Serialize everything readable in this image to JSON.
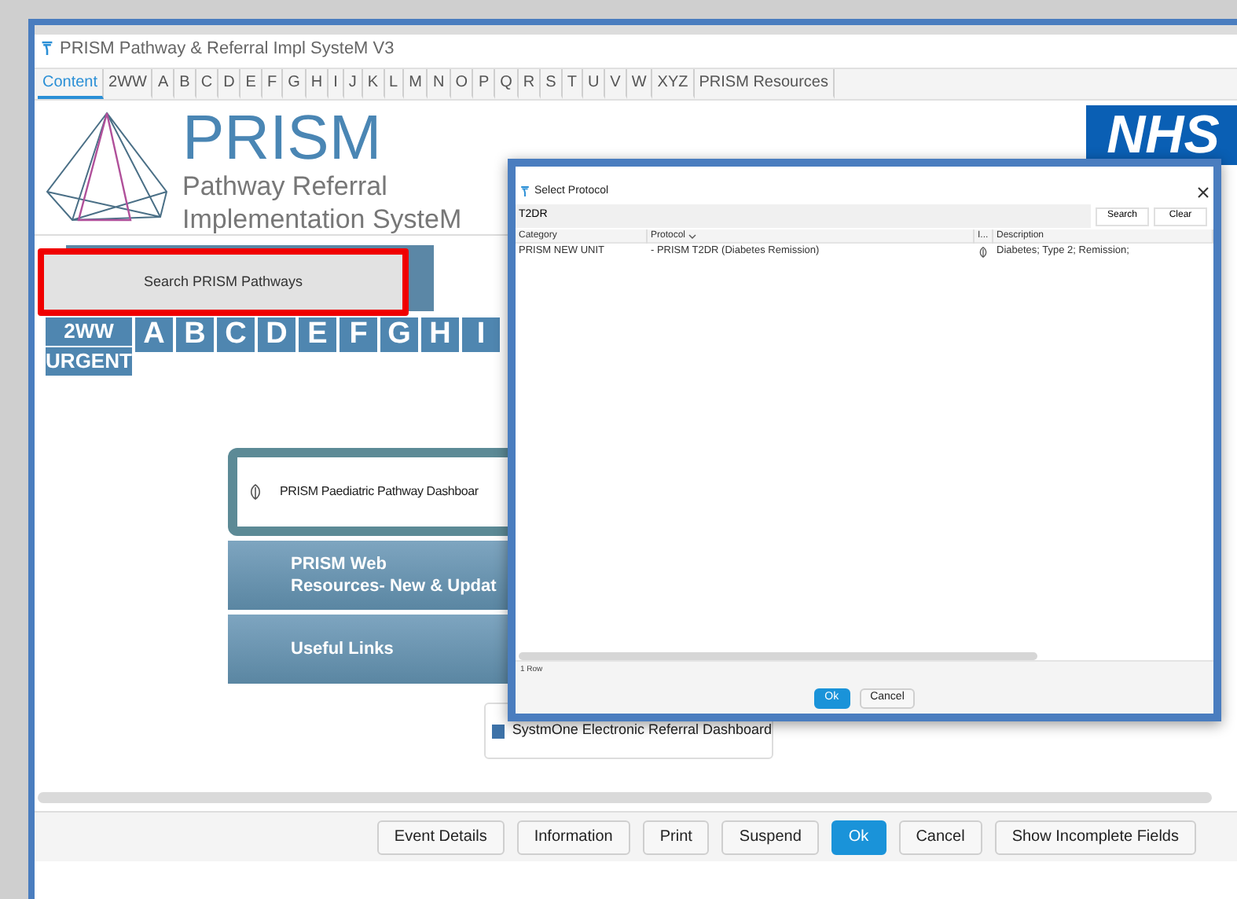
{
  "window": {
    "title": "PRISM Pathway & Referral Impl SysteM V3"
  },
  "tabs": [
    {
      "label": "Content",
      "selected": true
    },
    {
      "label": "2WW",
      "selected": false
    },
    {
      "label": "A",
      "selected": false
    },
    {
      "label": "B",
      "selected": false
    },
    {
      "label": "C",
      "selected": false
    },
    {
      "label": "D",
      "selected": false
    },
    {
      "label": "E",
      "selected": false
    },
    {
      "label": "F",
      "selected": false
    },
    {
      "label": "G",
      "selected": false
    },
    {
      "label": "H",
      "selected": false
    },
    {
      "label": "I",
      "selected": false
    },
    {
      "label": "J",
      "selected": false
    },
    {
      "label": "K",
      "selected": false
    },
    {
      "label": "L",
      "selected": false
    },
    {
      "label": "M",
      "selected": false
    },
    {
      "label": "N",
      "selected": false
    },
    {
      "label": "O",
      "selected": false
    },
    {
      "label": "P",
      "selected": false
    },
    {
      "label": "Q",
      "selected": false
    },
    {
      "label": "R",
      "selected": false
    },
    {
      "label": "S",
      "selected": false
    },
    {
      "label": "T",
      "selected": false
    },
    {
      "label": "U",
      "selected": false
    },
    {
      "label": "V",
      "selected": false
    },
    {
      "label": "W",
      "selected": false
    },
    {
      "label": "XYZ",
      "selected": false
    },
    {
      "label": "PRISM Resources",
      "selected": false
    }
  ],
  "header": {
    "brand": "PRISM",
    "subtitle_lines": [
      "Pathway Referral",
      "Implementation SysteM"
    ],
    "nhs_logo": "NHS"
  },
  "search_button": "Search PRISM Pathways",
  "letter_tiles": [
    "A",
    "B",
    "C",
    "D",
    "E",
    "F",
    "G",
    "H",
    "I"
  ],
  "urgent_tile": {
    "top": "2WW",
    "bottom": "URGENT"
  },
  "dashboard_card": "PRISM Paediatric Pathway Dashboar",
  "link_buttons": [
    {
      "lines": [
        "PRISM Web",
        "Resources- New & Updat"
      ]
    },
    {
      "lines": [
        "Useful Links"
      ]
    }
  ],
  "systmone_link": "SystmOne Electronic Referral Dashboard",
  "footer_buttons": [
    {
      "label": "Event Details",
      "primary": false
    },
    {
      "label": "Information",
      "primary": false
    },
    {
      "label": "Print",
      "primary": false
    },
    {
      "label": "Suspend",
      "primary": false
    },
    {
      "label": "Ok",
      "primary": true
    },
    {
      "label": "Cancel",
      "primary": false
    },
    {
      "label": "Show Incomplete Fields",
      "primary": false
    }
  ],
  "dialog": {
    "title": "Select Protocol",
    "search_value": "T2DR",
    "search_buttons": [
      "Search",
      "Clear"
    ],
    "columns": [
      "Category",
      "Protocol",
      "I...",
      "Description"
    ],
    "rows": [
      {
        "category": "PRISM NEW UNIT",
        "protocol": "- PRISM T2DR (Diabetes Remission)",
        "description": "Diabetes; Type 2; Remission;"
      }
    ],
    "row_count": "1 Row",
    "buttons": [
      {
        "label": "Ok",
        "primary": true
      },
      {
        "label": "Cancel",
        "primary": false
      }
    ]
  }
}
